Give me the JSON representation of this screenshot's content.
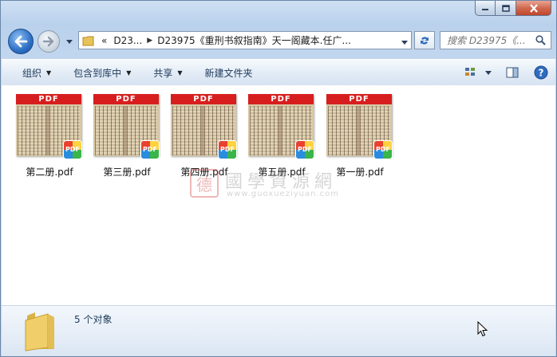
{
  "window": {
    "caption_buttons": [
      "minimize-icon",
      "maximize-icon",
      "close-icon"
    ]
  },
  "nav": {
    "back_icon": "arrow-left-icon",
    "forward_icon": "arrow-right-icon",
    "breadcrumb_overflow": "«",
    "breadcrumb": [
      "D23...",
      "D23975《重刑书叙指南》天一阁藏本.任广..."
    ],
    "search_placeholder": "搜索 D23975《..."
  },
  "toolbar": {
    "organize": "组织",
    "include_in_library": "包含到库中",
    "share": "共享",
    "new_folder": "新建文件夹"
  },
  "files": [
    {
      "name": "第二册.pdf",
      "badge": "PDF",
      "banner": "PDF"
    },
    {
      "name": "第三册.pdf",
      "badge": "PDF",
      "banner": "PDF"
    },
    {
      "name": "第四册.pdf",
      "badge": "PDF",
      "banner": "PDF"
    },
    {
      "name": "第五册.pdf",
      "badge": "PDF",
      "banner": "PDF"
    },
    {
      "name": "第一册.pdf",
      "badge": "PDF",
      "banner": "PDF"
    }
  ],
  "watermark": {
    "seal": "德",
    "title": "國學資源網",
    "url": "www.guoxueziyuan.com"
  },
  "status": {
    "count": "5 个对象"
  },
  "colors": {
    "pdf_banner": "#d71e1e",
    "window_frame": "#b9d1ec",
    "close_button": "#c0452b"
  }
}
